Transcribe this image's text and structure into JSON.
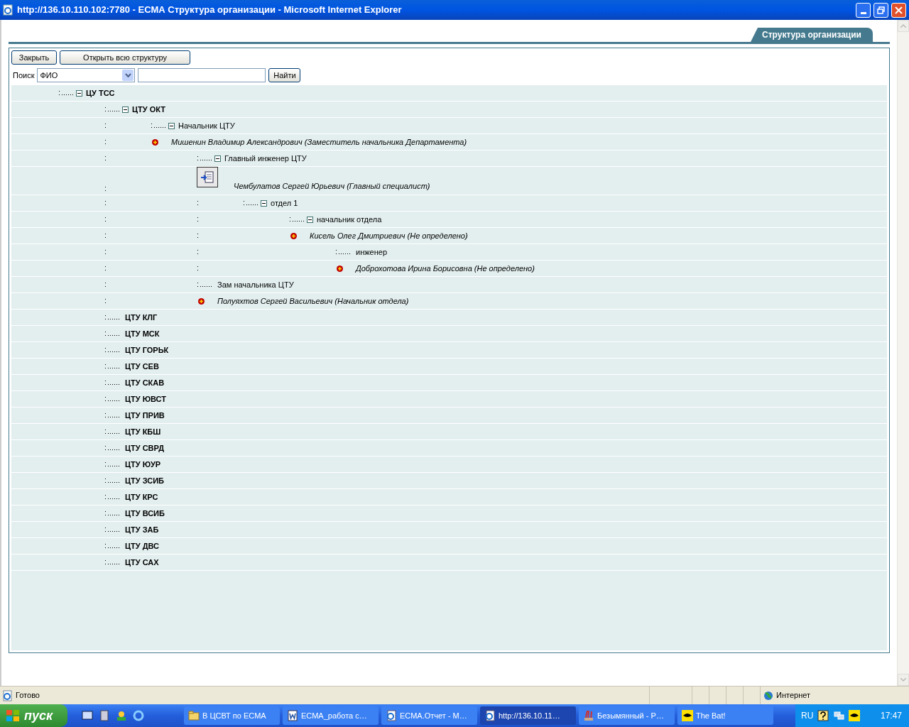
{
  "window": {
    "title": "http://136.10.110.102:7780 - ЕСМА Структура организации - Microsoft Internet Explorer"
  },
  "tab": {
    "label": "Структура организации",
    "selected": true
  },
  "toolbar": {
    "buttons": [
      "Закрыть",
      "Открыть всю структуру"
    ]
  },
  "search": {
    "label": "Поиск",
    "select_value": "ФИО",
    "button": "Найти"
  },
  "tree": [
    {
      "label": "ЦУ ТСС",
      "kind": "unit",
      "expanded": true,
      "children": [
        {
          "label": "ЦТУ ОКТ",
          "kind": "unit",
          "expanded": true,
          "children": [
            {
              "label": "Начальник ЦТУ",
              "kind": "position",
              "expanded": true,
              "children": [
                {
                  "label": "Мишенин Владимир Александрович (Заместитель начальника Департамента)",
                  "kind": "person"
                },
                {
                  "label": "Главный инженер ЦТУ",
                  "kind": "position",
                  "expanded": true,
                  "children": [
                    {
                      "label": "Чембулатов Сергей Юрьевич (Главный специалист)",
                      "kind": "person-card"
                    },
                    {
                      "label": "отдел 1",
                      "kind": "position",
                      "expanded": true,
                      "children": [
                        {
                          "label": "начальник отдела",
                          "kind": "position",
                          "expanded": true,
                          "children": [
                            {
                              "label": "Кисель Олег Дмитриевич (Не определено)",
                              "kind": "person"
                            },
                            {
                              "label": "инженер",
                              "kind": "position",
                              "expanded": false,
                              "children": [
                                {
                                  "label": "Доброхотова Ирина Борисовна (Не определено)",
                                  "kind": "person"
                                }
                              ]
                            }
                          ]
                        }
                      ]
                    }
                  ]
                },
                {
                  "label": "Зам начальника ЦТУ",
                  "kind": "position",
                  "expanded": false,
                  "children": [
                    {
                      "label": "Полуяхтов Сергей Васильевич (Начальник отдела)",
                      "kind": "person"
                    }
                  ]
                }
              ]
            }
          ]
        },
        {
          "label": "ЦТУ КЛГ",
          "kind": "unit",
          "expanded": false
        },
        {
          "label": "ЦТУ МСК",
          "kind": "unit",
          "expanded": false
        },
        {
          "label": "ЦТУ ГОРЬК",
          "kind": "unit",
          "expanded": false
        },
        {
          "label": "ЦТУ СЕВ",
          "kind": "unit",
          "expanded": false
        },
        {
          "label": "ЦТУ СКАВ",
          "kind": "unit",
          "expanded": false
        },
        {
          "label": "ЦТУ ЮВСТ",
          "kind": "unit",
          "expanded": false
        },
        {
          "label": "ЦТУ ПРИВ",
          "kind": "unit",
          "expanded": false
        },
        {
          "label": "ЦТУ КБШ",
          "kind": "unit",
          "expanded": false
        },
        {
          "label": "ЦТУ СВРД",
          "kind": "unit",
          "expanded": false
        },
        {
          "label": "ЦТУ ЮУР",
          "kind": "unit",
          "expanded": false
        },
        {
          "label": "ЦТУ ЗСИБ",
          "kind": "unit",
          "expanded": false
        },
        {
          "label": "ЦТУ КРС",
          "kind": "unit",
          "expanded": false
        },
        {
          "label": "ЦТУ ВСИБ",
          "kind": "unit",
          "expanded": false
        },
        {
          "label": "ЦТУ ЗАБ",
          "kind": "unit",
          "expanded": false
        },
        {
          "label": "ЦТУ ДВС",
          "kind": "unit",
          "expanded": false
        },
        {
          "label": "ЦТУ САХ",
          "kind": "unit",
          "expanded": false
        }
      ]
    }
  ],
  "status_bar": {
    "text": "Готово",
    "zone": "Интернет"
  },
  "taskbar": {
    "start": "пуск",
    "tasks": [
      {
        "label": "В ЦСВТ по ЕСМА",
        "kind": "folder",
        "selected": false
      },
      {
        "label": "ЕСМА_работа с…",
        "kind": "document",
        "selected": false
      },
      {
        "label": "ЕСМА.Отчет - М…",
        "kind": "web-page",
        "selected": false
      },
      {
        "label": "http://136.10.11…",
        "kind": "web-page",
        "selected": true
      },
      {
        "label": "Безымянный - P…",
        "kind": "paint",
        "selected": false
      },
      {
        "label": "The Bat!",
        "kind": "mail",
        "selected": false
      }
    ],
    "language": "RU",
    "clock": "17:47"
  }
}
